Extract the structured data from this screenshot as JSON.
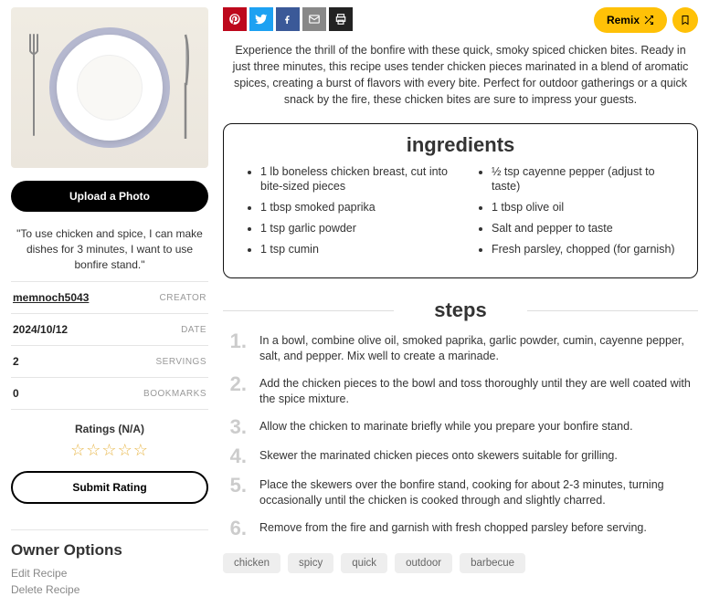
{
  "left": {
    "upload_label": "Upload a Photo",
    "quote": "\"To use chicken and spice, I can make dishes for 3 minutes, I want to use bonfire stand.\"",
    "meta": {
      "creator": {
        "value": "memnoch5043",
        "label": "CREATOR"
      },
      "date": {
        "value": "2024/10/12",
        "label": "DATE"
      },
      "servings": {
        "value": "2",
        "label": "SERVINGS"
      },
      "bookmarks": {
        "value": "0",
        "label": "BOOKMARKS"
      }
    },
    "ratings_label": "Ratings (N/A)",
    "stars": "☆☆☆☆☆",
    "submit_rating_label": "Submit Rating",
    "owner": {
      "heading": "Owner Options",
      "edit": "Edit Recipe",
      "delete": "Delete Recipe"
    }
  },
  "right": {
    "remix_label": "Remix",
    "description": "Experience the thrill of the bonfire with these quick, smoky spiced chicken bites. Ready in just three minutes, this recipe uses tender chicken pieces marinated in a blend of aromatic spices, creating a burst of flavors with every bite. Perfect for outdoor gatherings or a quick snack by the fire, these chicken bites are sure to impress your guests.",
    "ingredients_heading": "ingredients",
    "ingredients_col1": [
      "1 lb boneless chicken breast, cut into bite-sized pieces",
      "1 tbsp smoked paprika",
      "1 tsp garlic powder",
      "1 tsp cumin"
    ],
    "ingredients_col2": [
      "½ tsp cayenne pepper (adjust to taste)",
      "1 tbsp olive oil",
      "Salt and pepper to taste",
      "Fresh parsley, chopped (for garnish)"
    ],
    "steps_heading": "steps",
    "steps": [
      "In a bowl, combine olive oil, smoked paprika, garlic powder, cumin, cayenne pepper, salt, and pepper. Mix well to create a marinade.",
      "Add the chicken pieces to the bowl and toss thoroughly until they are well coated with the spice mixture.",
      "Allow the chicken to marinate briefly while you prepare your bonfire stand.",
      "Skewer the marinated chicken pieces onto skewers suitable for grilling.",
      "Place the skewers over the bonfire stand, cooking for about 2-3 minutes, turning occasionally until the chicken is cooked through and slightly charred.",
      "Remove from the fire and garnish with fresh chopped parsley before serving."
    ],
    "tags": [
      "chicken",
      "spicy",
      "quick",
      "outdoor",
      "barbecue"
    ]
  }
}
